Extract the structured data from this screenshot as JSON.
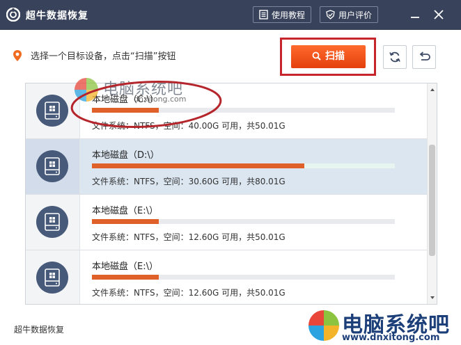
{
  "app": {
    "title": "超牛数据恢复"
  },
  "titlebar": {
    "tutorial_label": "使用教程",
    "review_label": "用户评价"
  },
  "toolbar": {
    "hint": "选择一个目标设备，点击“扫描”按钮",
    "scan_label": "扫描"
  },
  "disks": [
    {
      "name": "本地磁盘（C:\\）",
      "info": "文件系统：NTFS，空间：40.00G  可用，共50.01G",
      "usage": 0.22,
      "selected": false
    },
    {
      "name": "本地磁盘（D:\\）",
      "info": "文件系统：NTFS，空间：30.60G  可用，共80.01G",
      "usage": 0.7,
      "selected": true
    },
    {
      "name": "本地磁盘（E:\\）",
      "info": "文件系统：NTFS，空间：12.60G  可用，共50.01G",
      "usage": 0.22,
      "selected": false
    },
    {
      "name": "本地磁盘（E:\\）",
      "info": "文件系统：NTFS，空间：12.60G  可用，共50.01G",
      "usage": 0.22,
      "selected": false
    }
  ],
  "footer": {
    "text": "超牛数据恢复"
  },
  "watermark": {
    "top_cn": "电脑系统吧",
    "top_en": "dnxitong.com",
    "bottom_cn": "电脑系统吧",
    "bottom_en": "www.dnxitong.com"
  },
  "colors": {
    "titlebar": "#38425a",
    "accent": "#e4400d",
    "highlight_box": "#c6262b",
    "selected_row": "#dce6f1",
    "usage_bar": "#e0602a"
  },
  "icons": {
    "app": "app-logo-icon",
    "tutorial": "book-icon",
    "review": "shield-icon",
    "minimize": "minimize-icon",
    "close": "close-icon",
    "hint": "location-pin-icon",
    "scan": "search-icon",
    "refresh": "refresh-icon",
    "back": "back-icon",
    "disk": "disk-icon"
  }
}
